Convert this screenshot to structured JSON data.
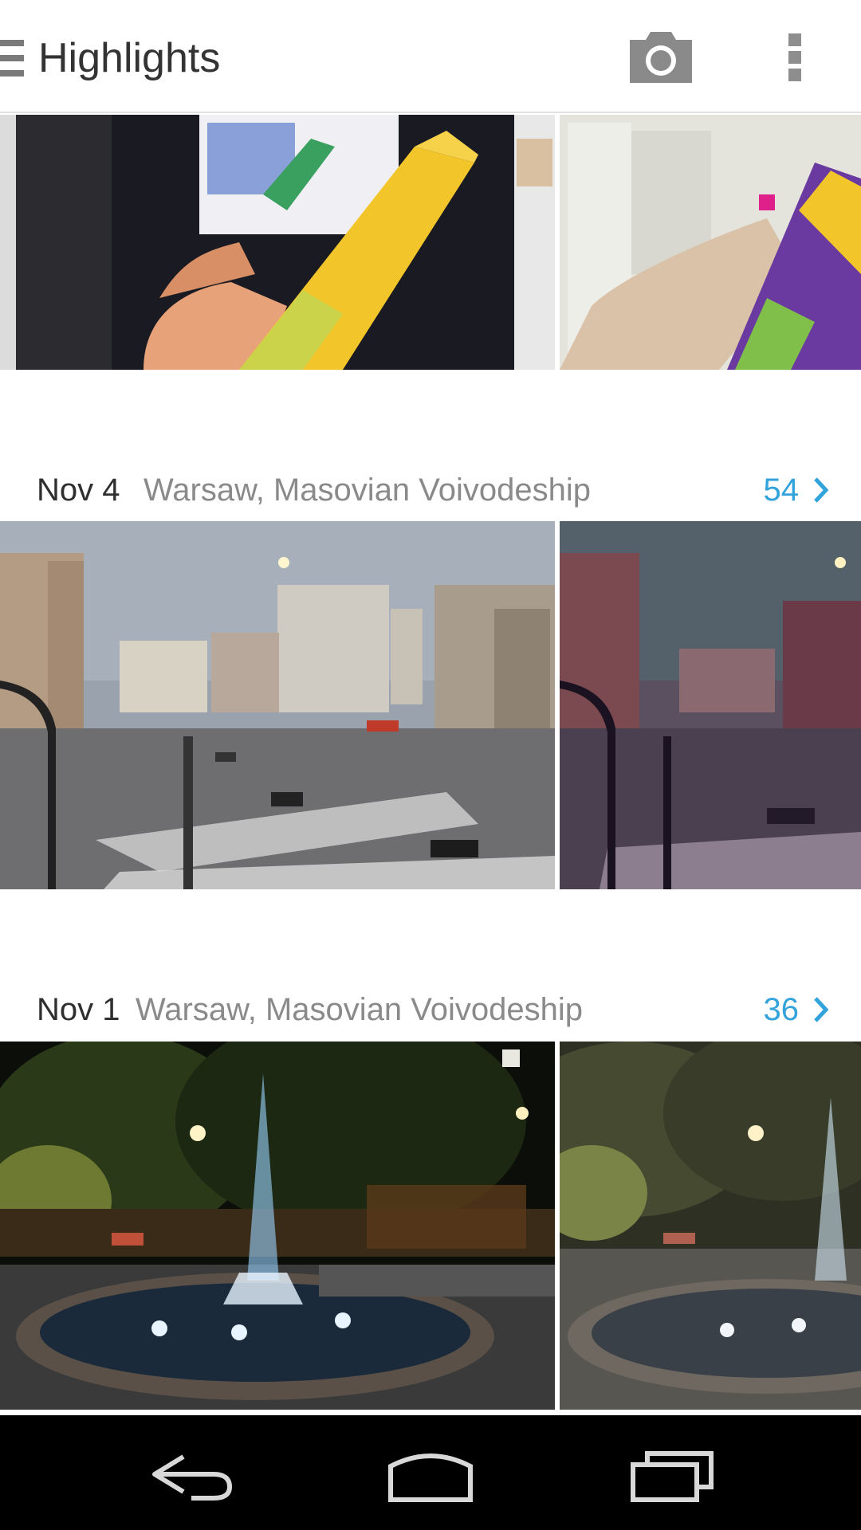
{
  "app_bar": {
    "title": "Highlights",
    "menu_icon": "hamburger-icon",
    "camera_icon": "camera-icon",
    "overflow_icon": "overflow-menu-icon"
  },
  "sections": [
    {
      "photos": [
        {
          "description_icon": "photo-mleko-tube"
        },
        {
          "description_icon": "photo-mleko-tube-hand"
        }
      ]
    },
    {
      "date": "Nov 4",
      "location": "Warsaw, Masovian Voivodeship",
      "count": "54",
      "photos": [
        {
          "description_icon": "photo-warsaw-street"
        },
        {
          "description_icon": "photo-warsaw-street-purple"
        }
      ]
    },
    {
      "date": "Nov 1",
      "location": "Warsaw, Masovian Voivodeship",
      "count": "36",
      "photos": [
        {
          "description_icon": "photo-fountain-night"
        },
        {
          "description_icon": "photo-fountain-night-faded"
        }
      ]
    }
  ],
  "nav_bar": {
    "back_icon": "back-icon",
    "home_icon": "home-icon",
    "recents_icon": "recent-apps-icon"
  },
  "colors": {
    "accent": "#33a3dc",
    "title": "#333333",
    "secondary_text": "#8a8a8a",
    "nav_background": "#000000"
  }
}
